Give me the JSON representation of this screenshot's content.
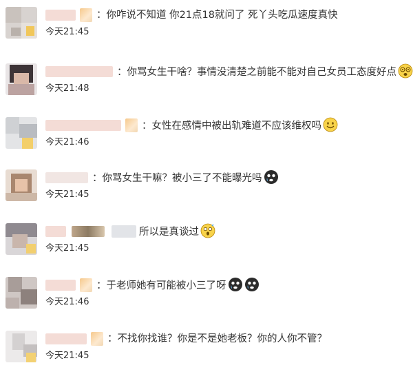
{
  "comments": [
    {
      "text": "：你咋说不知道 你21点18就问了 死丫头吃瓜速度真快",
      "time": "今天21:45",
      "emojis": []
    },
    {
      "text": "：你骂女生干啥？事情没清楚之前能不能对自己女员工态度好点",
      "time": "今天21:48",
      "emojis": [
        "dizzy-face-icon"
      ]
    },
    {
      "text": "：女性在感情中被出轨难道不应该维权吗",
      "time": "今天21:46",
      "emojis": [
        "smile-face-icon"
      ]
    },
    {
      "text": "：你骂女生干嘛？被小三了不能曝光吗",
      "time": "今天21:45",
      "emojis": [
        "crying-black-face-icon"
      ]
    },
    {
      "text": "所以是真谈过",
      "time": "今天21:45",
      "emojis": [
        "shocked-face-icon"
      ]
    },
    {
      "text": "：于老师她有可能被小三了呀",
      "time": "今天21:46",
      "emojis": [
        "crying-black-face-icon",
        "crying-black-face-icon"
      ]
    },
    {
      "text": "：不找你找谁？你是不是她老板？你的人你不管？",
      "time": "今天21:45",
      "emojis": []
    }
  ]
}
